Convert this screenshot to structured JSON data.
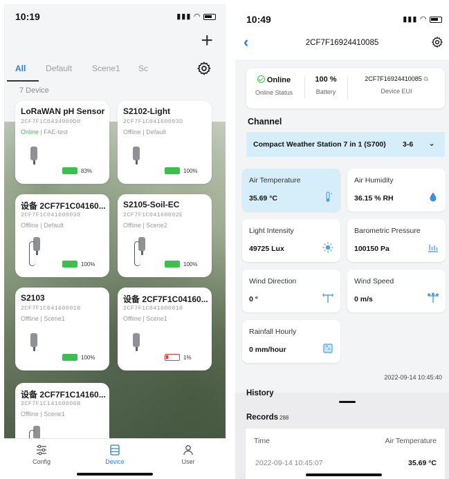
{
  "left": {
    "status_time": "10:19",
    "tabs": [
      {
        "label": "All"
      },
      {
        "label": "Default"
      },
      {
        "label": "Scene1"
      },
      {
        "label": "Sc"
      }
    ],
    "device_count": "7 Device",
    "devices": [
      {
        "name": "LoRaWAN pH Sensor",
        "eui": "2CF7F1C0434000D0",
        "status": "Online",
        "group": "FAE-test",
        "battery": "83%"
      },
      {
        "name": "S2102-Light",
        "eui": "2CF7F1C04160003D",
        "status": "Offline",
        "group": "Default",
        "battery": "100%"
      },
      {
        "name": "设备 2CF7F1C04160...",
        "eui": "2CF7F1C041600038",
        "status": "Offline",
        "group": "Default",
        "battery": "100%"
      },
      {
        "name": "S2105-Soil-EC",
        "eui": "2CF7F1C04160002E",
        "status": "Offline",
        "group": "Scene2",
        "battery": "100%"
      },
      {
        "name": "S2103",
        "eui": "2CF7F1C041600016",
        "status": "Offline",
        "group": "Scene1",
        "battery": "100%"
      },
      {
        "name": "设备 2CF7F1C04160...",
        "eui": "2CF7F1C041600010",
        "status": "Offline",
        "group": "Scene1",
        "battery": "1%"
      },
      {
        "name": "设备 2CF7F1C14160...",
        "eui": "2CF7F1C14160006B",
        "status": "Offline",
        "group": "Scene1"
      }
    ],
    "nav": [
      {
        "label": "Config"
      },
      {
        "label": "Device"
      },
      {
        "label": "User"
      }
    ]
  },
  "right": {
    "status_time": "10:49",
    "title": "2CF7F16924410085",
    "info": {
      "online_value": "Online",
      "online_label": "Online Status",
      "battery_value": "100 %",
      "battery_label": "Battery",
      "eui_value": "2CF7F16924410085",
      "eui_label": "Device EUI"
    },
    "channel_label": "Channel",
    "channel_name": "Compact Weather Station 7 in 1 (S700)",
    "channel_range": "3-6",
    "measurements": [
      {
        "title": "Air Temperature",
        "value": "35.69 °C",
        "icon": "thermometer-icon"
      },
      {
        "title": "Air Humidity",
        "value": "36.15 % RH",
        "icon": "water-drop-icon"
      },
      {
        "title": "Light Intensity",
        "value": "49725 Lux",
        "icon": "sun-icon"
      },
      {
        "title": "Barometric Pressure",
        "value": "100150 Pa",
        "icon": "pressure-icon"
      },
      {
        "title": "Wind Direction",
        "value": "0 °",
        "icon": "wind-vane-icon"
      },
      {
        "title": "Wind Speed",
        "value": "0 m/s",
        "icon": "anemometer-icon"
      },
      {
        "title": "Rainfall Hourly",
        "value": "0 mm/hour",
        "icon": "rain-gauge-icon"
      }
    ],
    "updated": "2022-09-14 10:45:40",
    "history_label": "History",
    "records_label": "Records",
    "records_count": "288",
    "table": {
      "col_time": "Time",
      "col_value": "Air Temperature",
      "row_time": "2022-09-14 10:45:07",
      "row_value": "35.69 °C"
    }
  },
  "colors": {
    "accent": "#2a7de1",
    "online": "#3cbf4c",
    "low_battery": "#e03a3a",
    "highlight": "#d6eef9"
  }
}
